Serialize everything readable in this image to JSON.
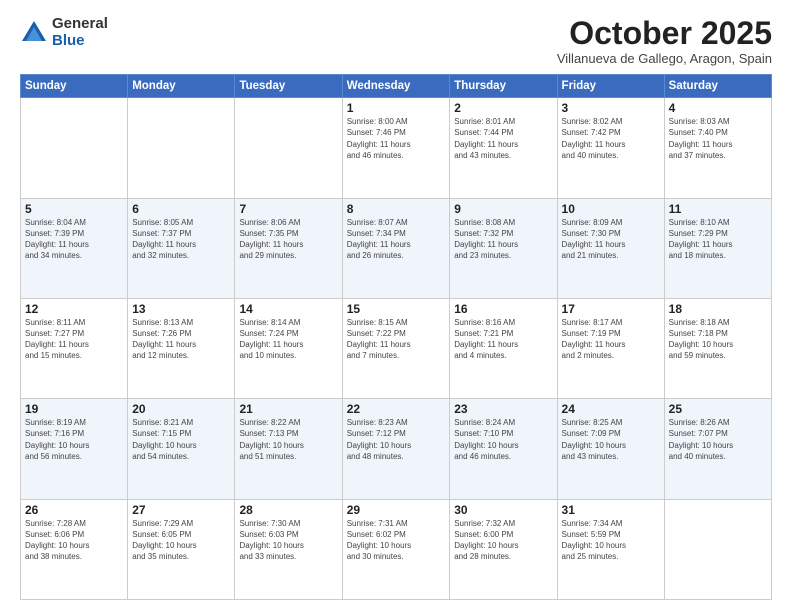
{
  "logo": {
    "general": "General",
    "blue": "Blue"
  },
  "header": {
    "month": "October 2025",
    "location": "Villanueva de Gallego, Aragon, Spain"
  },
  "weekdays": [
    "Sunday",
    "Monday",
    "Tuesday",
    "Wednesday",
    "Thursday",
    "Friday",
    "Saturday"
  ],
  "weeks": [
    [
      {
        "day": "",
        "info": ""
      },
      {
        "day": "",
        "info": ""
      },
      {
        "day": "",
        "info": ""
      },
      {
        "day": "1",
        "info": "Sunrise: 8:00 AM\nSunset: 7:46 PM\nDaylight: 11 hours\nand 46 minutes."
      },
      {
        "day": "2",
        "info": "Sunrise: 8:01 AM\nSunset: 7:44 PM\nDaylight: 11 hours\nand 43 minutes."
      },
      {
        "day": "3",
        "info": "Sunrise: 8:02 AM\nSunset: 7:42 PM\nDaylight: 11 hours\nand 40 minutes."
      },
      {
        "day": "4",
        "info": "Sunrise: 8:03 AM\nSunset: 7:40 PM\nDaylight: 11 hours\nand 37 minutes."
      }
    ],
    [
      {
        "day": "5",
        "info": "Sunrise: 8:04 AM\nSunset: 7:39 PM\nDaylight: 11 hours\nand 34 minutes."
      },
      {
        "day": "6",
        "info": "Sunrise: 8:05 AM\nSunset: 7:37 PM\nDaylight: 11 hours\nand 32 minutes."
      },
      {
        "day": "7",
        "info": "Sunrise: 8:06 AM\nSunset: 7:35 PM\nDaylight: 11 hours\nand 29 minutes."
      },
      {
        "day": "8",
        "info": "Sunrise: 8:07 AM\nSunset: 7:34 PM\nDaylight: 11 hours\nand 26 minutes."
      },
      {
        "day": "9",
        "info": "Sunrise: 8:08 AM\nSunset: 7:32 PM\nDaylight: 11 hours\nand 23 minutes."
      },
      {
        "day": "10",
        "info": "Sunrise: 8:09 AM\nSunset: 7:30 PM\nDaylight: 11 hours\nand 21 minutes."
      },
      {
        "day": "11",
        "info": "Sunrise: 8:10 AM\nSunset: 7:29 PM\nDaylight: 11 hours\nand 18 minutes."
      }
    ],
    [
      {
        "day": "12",
        "info": "Sunrise: 8:11 AM\nSunset: 7:27 PM\nDaylight: 11 hours\nand 15 minutes."
      },
      {
        "day": "13",
        "info": "Sunrise: 8:13 AM\nSunset: 7:26 PM\nDaylight: 11 hours\nand 12 minutes."
      },
      {
        "day": "14",
        "info": "Sunrise: 8:14 AM\nSunset: 7:24 PM\nDaylight: 11 hours\nand 10 minutes."
      },
      {
        "day": "15",
        "info": "Sunrise: 8:15 AM\nSunset: 7:22 PM\nDaylight: 11 hours\nand 7 minutes."
      },
      {
        "day": "16",
        "info": "Sunrise: 8:16 AM\nSunset: 7:21 PM\nDaylight: 11 hours\nand 4 minutes."
      },
      {
        "day": "17",
        "info": "Sunrise: 8:17 AM\nSunset: 7:19 PM\nDaylight: 11 hours\nand 2 minutes."
      },
      {
        "day": "18",
        "info": "Sunrise: 8:18 AM\nSunset: 7:18 PM\nDaylight: 10 hours\nand 59 minutes."
      }
    ],
    [
      {
        "day": "19",
        "info": "Sunrise: 8:19 AM\nSunset: 7:16 PM\nDaylight: 10 hours\nand 56 minutes."
      },
      {
        "day": "20",
        "info": "Sunrise: 8:21 AM\nSunset: 7:15 PM\nDaylight: 10 hours\nand 54 minutes."
      },
      {
        "day": "21",
        "info": "Sunrise: 8:22 AM\nSunset: 7:13 PM\nDaylight: 10 hours\nand 51 minutes."
      },
      {
        "day": "22",
        "info": "Sunrise: 8:23 AM\nSunset: 7:12 PM\nDaylight: 10 hours\nand 48 minutes."
      },
      {
        "day": "23",
        "info": "Sunrise: 8:24 AM\nSunset: 7:10 PM\nDaylight: 10 hours\nand 46 minutes."
      },
      {
        "day": "24",
        "info": "Sunrise: 8:25 AM\nSunset: 7:09 PM\nDaylight: 10 hours\nand 43 minutes."
      },
      {
        "day": "25",
        "info": "Sunrise: 8:26 AM\nSunset: 7:07 PM\nDaylight: 10 hours\nand 40 minutes."
      }
    ],
    [
      {
        "day": "26",
        "info": "Sunrise: 7:28 AM\nSunset: 6:06 PM\nDaylight: 10 hours\nand 38 minutes."
      },
      {
        "day": "27",
        "info": "Sunrise: 7:29 AM\nSunset: 6:05 PM\nDaylight: 10 hours\nand 35 minutes."
      },
      {
        "day": "28",
        "info": "Sunrise: 7:30 AM\nSunset: 6:03 PM\nDaylight: 10 hours\nand 33 minutes."
      },
      {
        "day": "29",
        "info": "Sunrise: 7:31 AM\nSunset: 6:02 PM\nDaylight: 10 hours\nand 30 minutes."
      },
      {
        "day": "30",
        "info": "Sunrise: 7:32 AM\nSunset: 6:00 PM\nDaylight: 10 hours\nand 28 minutes."
      },
      {
        "day": "31",
        "info": "Sunrise: 7:34 AM\nSunset: 5:59 PM\nDaylight: 10 hours\nand 25 minutes."
      },
      {
        "day": "",
        "info": ""
      }
    ]
  ]
}
